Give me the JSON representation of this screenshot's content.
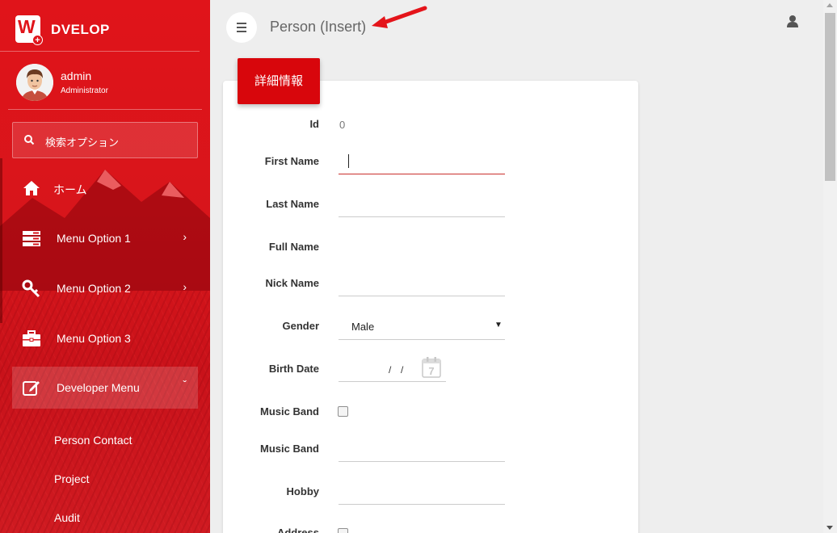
{
  "app": {
    "brand": "DVELOP",
    "logo_letter": "W"
  },
  "user": {
    "name": "admin",
    "role": "Administrator"
  },
  "search": {
    "placeholder": "検索オプション"
  },
  "sidebar": {
    "items": [
      {
        "label": "ホーム",
        "icon": "home-icon"
      },
      {
        "label": "Menu Option 1",
        "icon": "server-icon",
        "chevron": "›"
      },
      {
        "label": "Menu Option 2",
        "icon": "key-icon",
        "chevron": "›"
      },
      {
        "label": "Menu Option 3",
        "icon": "briefcase-icon"
      },
      {
        "label": "Developer Menu",
        "icon": "edit-icon",
        "chevron": "ˇ"
      }
    ],
    "subitems": [
      "Person Contact",
      "Project",
      "Audit"
    ]
  },
  "header": {
    "title": "Person",
    "mode": "(Insert)"
  },
  "card": {
    "tab_label": "詳細情報"
  },
  "form": {
    "id_label": "Id",
    "id_value": "0",
    "first_name_label": "First Name",
    "first_name_value": "",
    "last_name_label": "Last Name",
    "full_name_label": "Full Name",
    "nick_name_label": "Nick Name",
    "gender_label": "Gender",
    "gender_value": "Male",
    "birth_date_label": "Birth Date",
    "birth_date_sep1": "/",
    "birth_date_sep2": "/",
    "music_band_check_label": "Music Band",
    "music_band_text_label": "Music Band",
    "hobby_label": "Hobby",
    "address_label": "Address"
  },
  "colors": {
    "sidebar": "#e0141a",
    "accent": "#d8060c",
    "background": "#eeeeee"
  }
}
